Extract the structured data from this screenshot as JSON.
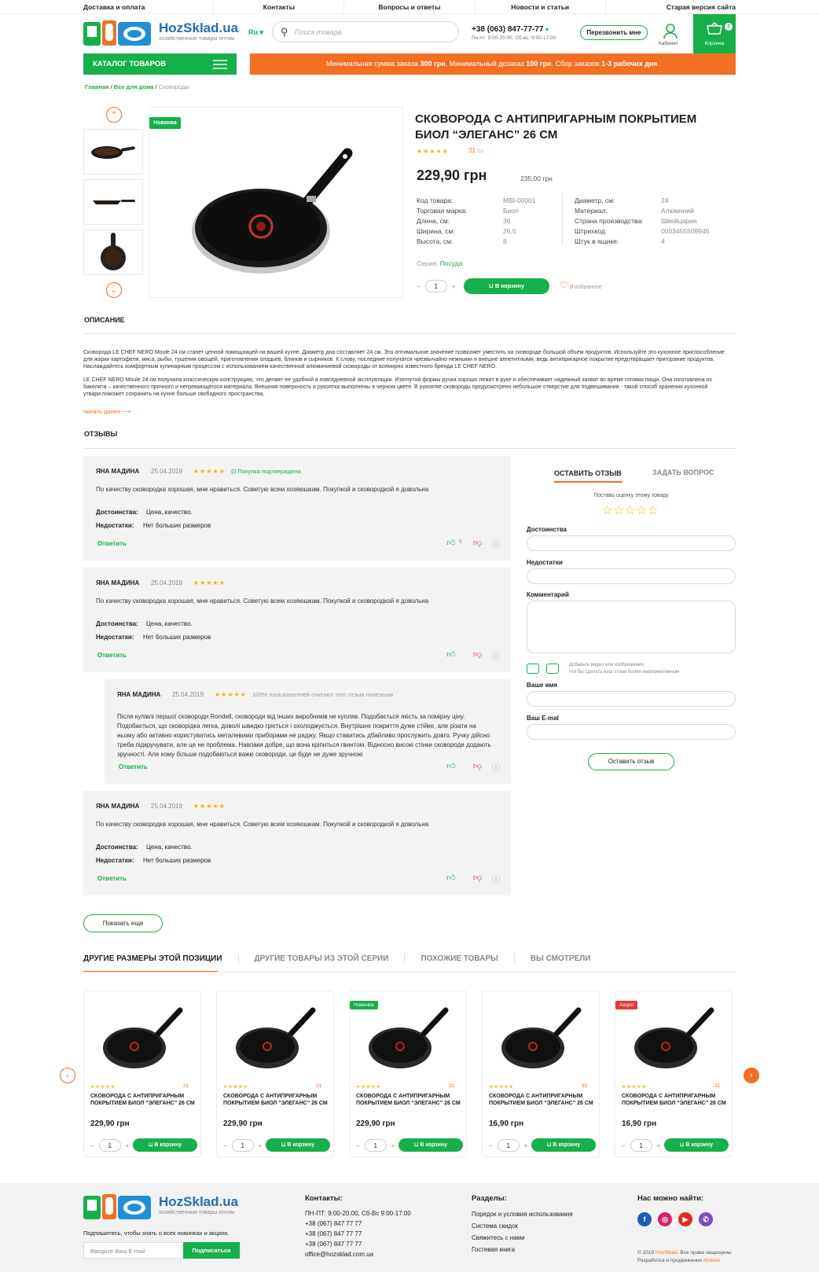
{
  "topnav": [
    "Доставка и оплата",
    "Контакты",
    "Вопросы и ответы",
    "Новости и статьи",
    "Старая версия сайта"
  ],
  "logo": {
    "name": "HozSklad.ua",
    "tagline": "хозяйственные товары оптом"
  },
  "header": {
    "lang": "Ru",
    "search_placeholder": "Поиск товара",
    "phone": "+38 (063) 847-77-77",
    "hours": "Пн-пт: 9:00-20:00; Сб-вс: 9:00-17:00",
    "callback": "Перезвонить мне",
    "cabinet": "Кабинет",
    "cart": "Корзина",
    "cart_count": "0"
  },
  "catalog_btn": "КАТАЛОГ ТОВАРОВ",
  "banner": {
    "t1": "Минимальная сумма заказа ",
    "b1": "300 грн",
    "t2": ". Минимальный дозаказ ",
    "b2": "100 грн",
    "t3": ". Сбор заказов ",
    "b3": "1-3 рабочих дня",
    "t4": "."
  },
  "breadcrumb": {
    "home": "Главная",
    "cat": "Все для дома",
    "current": "Сковороды",
    "sep": " / "
  },
  "product": {
    "badge": "Новинка",
    "title1": "СКОВОРОДА С АНТИПРИГАРНЫМ ПОКРЫТИЕМ",
    "title2": "БИОЛ “ЭЛЕГАНС” 26 СМ",
    "reviews_count": "31",
    "price": "229,90 грн",
    "old_price": "235,00 грн",
    "specs_left": [
      [
        "Код товара:",
        "MBI-00001"
      ],
      [
        "Торговая марка:",
        "Биол"
      ],
      [
        "Длина, см:",
        "36"
      ],
      [
        "Ширина, см:",
        "26,5"
      ],
      [
        "Высота, см:",
        "8"
      ]
    ],
    "specs_right": [
      [
        "Диаметр, см:",
        "24"
      ],
      [
        "Материал:",
        "Алюминий"
      ],
      [
        "Страна производства:",
        "Швейцария"
      ],
      [
        "Штрихкод:",
        "0003455509945"
      ],
      [
        "Штук в ящике:",
        "4"
      ]
    ],
    "series_label": "Серия:",
    "series": "Посуда",
    "qty": "1",
    "cart_btn": "В корзину",
    "fav": "В избранное",
    "rating": 4.5
  },
  "description": {
    "heading": "ОПИСАНИЕ",
    "p1": "Сковорода LE CHEF NERO Moule 24 см станет ценной помощницей на вашей кухне. Диаметр дна составляет 24 см. Это оптимальное значение позволяет уместить на сковороде большой объем продуктов. Используйте это кухонное приспособление для жарки картофеля, мяса, рыбы, тушения овощей, приготовления оладьев, блинов и сырников. К слову, последние получатся чрезвычайно нежными и внешне аппетитными, ведь антипригарное покрытие предотвращает пригорание продуктов. Наслаждайтесь комфортным кулинарным процессом с использованием качественной алюминиевой сковороды от всемирно известного бренда LE CHEF NERO.",
    "p2": "LE CHEF NERO Moule 24 см получила классическую конструкцию, что делает ее удобной в повседневной эксплуатации. Изогнутой формы ручка хорошо лежит в руке и обеспечивает надежный захват во время готовки пищи. Она изготовлена из бакелита – качественного прочного и негревающегося материала. Внешняя поверхность и рукоятка выполнены в черном цвете. В рукоятке сковороды предусмотрено небольшое отверстие для подвешивания - такой способ хранения кухонной утвари поможет сохранить на кухне больше свободного пространства.",
    "more": "Читать далее"
  },
  "reviews_heading": "ОТЗЫВЫ",
  "reviews": [
    {
      "name": "ЯНА МАДИНА",
      "date": "25.04.2019",
      "extra": "Покупка подтверждена",
      "text": "По качеству сковородка хорошая, мне нравиться. Советую всем хозяюшкам. Покупкой и сковородкой я довольна",
      "pros_l": "Достоинства:",
      "pros": "Цена, качество.",
      "cons_l": "Недостатки:",
      "cons": "Нет больших размеров",
      "reply": "Ответить",
      "likes": "5"
    },
    {
      "name": "ЯНА МАДИНА",
      "date": "25.04.2019",
      "text": "По качеству сковородка хорошая, мне нравиться. Советую всем хозяюшкам. Покупкой и сковородкой я довольна",
      "pros_l": "Достоинства:",
      "pros": "Цена, качество.",
      "cons_l": "Недостатки:",
      "cons": "Нет больших размеров",
      "reply": "Ответить"
    },
    {
      "name": "ЯНА МАДИНА",
      "date": "25.04.2019",
      "extra": "100% пользователей считают этот отзыв полезным",
      "text": "Після купівлі першої сковороди Rondell, сковороди від інших виробників не купляв. Подобається якість за помірну ціну. Подобається, що сковорідка легка, доволі швидко гріється і охолоджується. Внутрішнє покриття дуже стійке, але різати на ньому або активно користуватись металевими приборами не раджу. Якщо ставитись дбайливо прослужить довго. Ручку дійсно треба підкручувати, але це не проблема. Навпаки добре, що вона кріпиться гвинтом. Відносно високі стінки сковороди додають зручності. Але кому більше подобаються важкі сковороди, це буде не дуже зручною",
      "reply": "Ответить"
    },
    {
      "name": "ЯНА МАДИНА",
      "date": "25.04.2019",
      "text": "По качеству сковородка хорошая, мне нравиться. Советую всем хозяюшкам. Покупкой и сковородкой я довольна",
      "pros_l": "Достоинства:",
      "pros": "Цена, качество.",
      "cons_l": "Недостатки:",
      "cons": "Нет больших размеров",
      "reply": "Ответить"
    }
  ],
  "show_more": "Показать еще",
  "form": {
    "tab1": "ОСТАВИТЬ ОТЗЫВ",
    "tab2": "ЗАДАТЬ ВОПРОС",
    "rate": "Поставь оценку этому товару",
    "pros": "Достоинства",
    "cons": "Недостатки",
    "comment": "Комментарий",
    "media1": "Добавьте видео или изображения,",
    "media2": "что бы сделать ваш отзыв более информативным",
    "name": "Ваше имя",
    "email": "Ваш E-mal",
    "submit": "Оставить отзыв"
  },
  "tabs": [
    "ДРУГИЕ РАЗМЕРЫ ЭТОЙ ПОЗИЦИИ",
    "ДРУГИЕ ТОВАРЫ ИЗ ЭТОЙ СЕРИИ",
    "ПОХОЖИЕ ТОВАРЫ",
    "ВЫ СМОТРЕЛИ"
  ],
  "cards": [
    {
      "badge": "",
      "count": "31",
      "title": "СКОВОРОДА С АНТИПРИГАРНЫМ ПОКРЫТИЕМ БИОЛ “ЭЛЕГАНС” 26 СМ",
      "price": "229,90 грн",
      "qty": "1",
      "btn": "В корзину"
    },
    {
      "badge": "",
      "count": "31",
      "title": "СКОВОРОДА С АНТИПРИГАРНЫМ ПОКРЫТИЕМ БИОЛ “ЭЛЕГАНС” 26 СМ",
      "price": "229,90 грн",
      "qty": "1",
      "btn": "В корзину"
    },
    {
      "badge": "Новинка",
      "count": "31",
      "title": "СКОВОРОДА С АНТИПРИГАРНЫМ ПОКРЫТИЕМ БИОЛ “ЭЛЕГАНС” 26 СМ",
      "price": "229,90 грн",
      "qty": "1",
      "btn": "В корзину"
    },
    {
      "badge": "",
      "count": "31",
      "title": "СКОВОРОДА С АНТИПРИГАРНЫМ ПОКРЫТИЕМ БИОЛ “ЭЛЕГАНС” 26 СМ",
      "price": "16,90 грн",
      "qty": "1",
      "btn": "В корзину"
    },
    {
      "badge": "Акция",
      "count": "31",
      "title": "СКОВОРОДА С АНТИПРИГАРНЫМ ПОКРЫТИЕМ БИОЛ “ЭЛЕГАНС” 26 СМ",
      "price": "16,90 грн",
      "qty": "1",
      "btn": "В корзину"
    }
  ],
  "footer": {
    "subscribe_text": "Подпишитесь, чтобы знать о всех новинках и акциях.",
    "email_placeholder": "Введите Ваш E-mail",
    "subscribe_btn": "Подписаться",
    "contacts_h": "Контакты:",
    "contacts": [
      "ПН-ПТ: 9:00-20:00, Сб-Вс 9:00-17:00",
      "+38 (067) 847 77 77",
      "+38 (067) 847 77 77",
      "+38 (067) 847 77 77",
      "office@hozsklad.com.ua"
    ],
    "sections_h": "Разделы:",
    "sections": [
      "Порядок и условия использования",
      "Система скидок",
      "Свяжитесь с нами",
      "Гостевая книга"
    ],
    "find_h": "Нас можно найти:",
    "copy1": "© 2019 ",
    "copy_brand": "HozSklad",
    "copy2": ". Все права защищены",
    "dev1": "Разработка и продвижение ",
    "dev_brand": "Mobios"
  },
  "colors": {
    "green": "#16b04a",
    "orange": "#f36f21"
  }
}
